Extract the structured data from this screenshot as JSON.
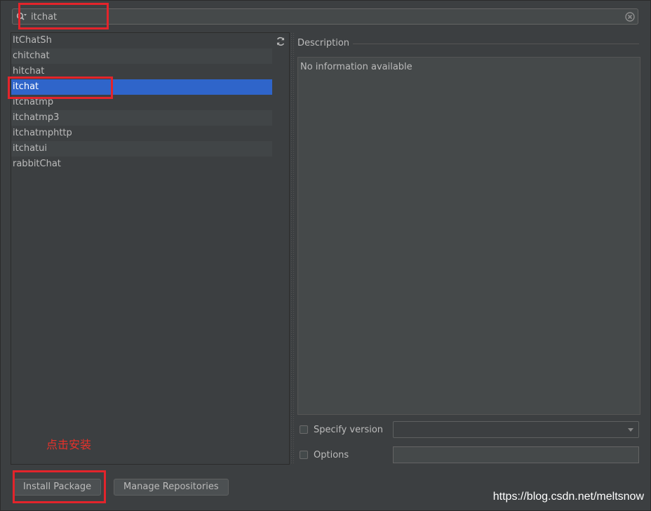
{
  "search": {
    "value": "itchat",
    "placeholder": ""
  },
  "packages": [
    {
      "name": "ItChatSh"
    },
    {
      "name": "chitchat"
    },
    {
      "name": "hitchat"
    },
    {
      "name": "itchat",
      "selected": true
    },
    {
      "name": "itchatmp"
    },
    {
      "name": "itchatmp3"
    },
    {
      "name": "itchatmphttp"
    },
    {
      "name": "itchatui"
    },
    {
      "name": "rabbitChat"
    }
  ],
  "description": {
    "label": "Description",
    "text": "No information available"
  },
  "options": {
    "specify_version_label": "Specify version",
    "options_label": "Options",
    "version_value": "",
    "options_value": ""
  },
  "hint": "点击安装",
  "buttons": {
    "install": "Install Package",
    "manage": "Manage Repositories"
  },
  "watermark": "https://blog.csdn.net/meltsnow",
  "colors": {
    "accent": "#2f65ca",
    "annotation": "#e3242b"
  },
  "icons": {
    "search": "search-icon",
    "clear": "clear-icon",
    "refresh": "refresh-icon"
  }
}
